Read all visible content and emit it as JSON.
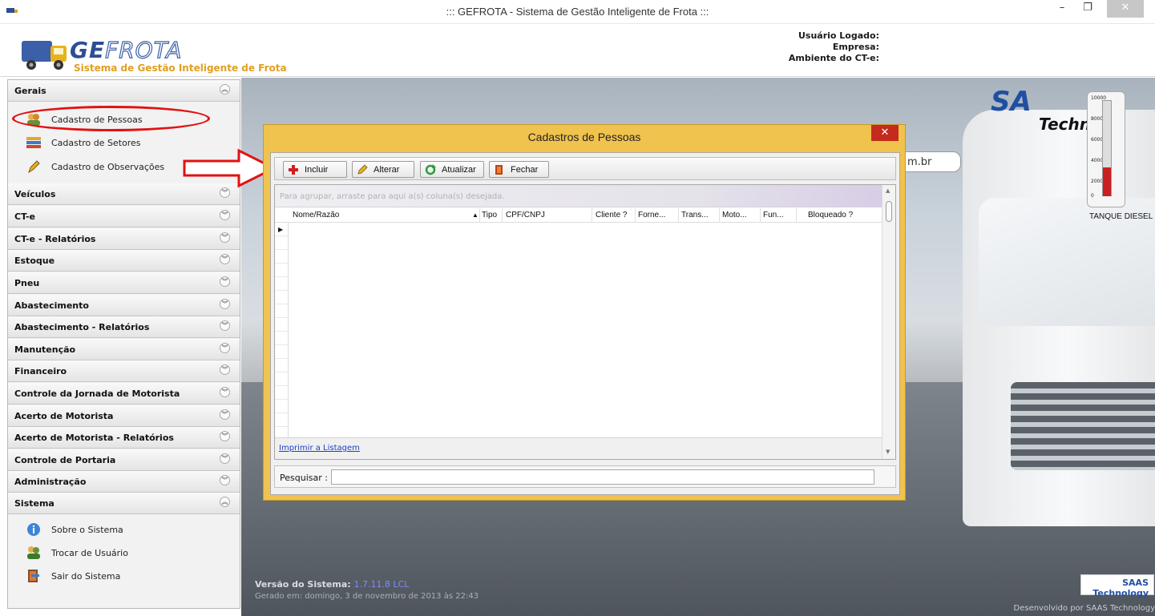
{
  "window": {
    "title": "::: GEFROTA - Sistema de Gestão Inteligente de Frota :::",
    "minimize": "–",
    "maximize": "❐",
    "close": "✕"
  },
  "header": {
    "brand_part1": "GE",
    "brand_part2": "FROTA",
    "subtitle": "Sistema de Gestão Inteligente de Frota",
    "user_logged_label": "Usuário Logado:",
    "company_label": "Empresa:",
    "cte_env_label": "Ambiente do CT-e:"
  },
  "sidebar": {
    "groups": [
      {
        "label": "Gerais",
        "expanded": true,
        "items": [
          {
            "label": "Cadastro de Pessoas",
            "icon": "people-icon"
          },
          {
            "label": "Cadastro de Setores",
            "icon": "stack-icon"
          },
          {
            "label": "Cadastro de Observações",
            "icon": "pencil-icon"
          }
        ]
      },
      {
        "label": "Veículos",
        "expanded": false
      },
      {
        "label": "CT-e",
        "expanded": false
      },
      {
        "label": "CT-e - Relatórios",
        "expanded": false
      },
      {
        "label": "Estoque",
        "expanded": false
      },
      {
        "label": "Pneu",
        "expanded": false
      },
      {
        "label": "Abastecimento",
        "expanded": false
      },
      {
        "label": "Abastecimento - Relatórios",
        "expanded": false
      },
      {
        "label": "Manutenção",
        "expanded": false
      },
      {
        "label": "Financeiro",
        "expanded": false
      },
      {
        "label": "Controle da Jornada de Motorista",
        "expanded": false
      },
      {
        "label": "Acerto de Motorista",
        "expanded": false
      },
      {
        "label": "Acerto de Motorista - Relatórios",
        "expanded": false
      },
      {
        "label": "Controle de Portaria",
        "expanded": false
      },
      {
        "label": "Administração",
        "expanded": false
      },
      {
        "label": "Sistema",
        "expanded": true,
        "items": [
          {
            "label": "Sobre o Sistema",
            "icon": "info-icon"
          },
          {
            "label": "Trocar de Usuário",
            "icon": "users-icon"
          },
          {
            "label": "Sair do Sistema",
            "icon": "exit-icon"
          }
        ]
      }
    ],
    "chev_up": "︽",
    "chev_down": "︾"
  },
  "background": {
    "site_fragment": "m.br",
    "saas_logo": "SA",
    "saas_tech": "Techn",
    "tank_label": "TANQUE DIESEL",
    "gauge_ticks": [
      "10000",
      "8000",
      "6000",
      "4000",
      "2000",
      "0"
    ],
    "tank_level_percent": 30,
    "version_label": "Versão do Sistema:",
    "version_number": "1.7.11.8 LCL",
    "generated": "Gerado em: domingo, 3 de novembro de 2013 às 22:43",
    "footer_logo": "SAAS Technology",
    "developed_by": "Desenvolvido por SAAS Technology"
  },
  "dialog": {
    "title": "Cadastros de Pessoas",
    "close": "✕",
    "toolbar": {
      "include": "Incluir",
      "alter": "Alterar",
      "update": "Atualizar",
      "close": "Fechar"
    },
    "grid": {
      "group_hint": "Para agrupar, arraste para aqui a(s) coluna(s) desejada.",
      "columns": [
        "Nome/Razão",
        "Tipo",
        "CPF/CNPJ",
        "Cliente ?",
        "Forne...",
        "Trans...",
        "Moto...",
        "Fun...",
        "Bloqueado ?"
      ],
      "sort_indicator": "▲",
      "row_pointer": "▶",
      "print_link": "Imprimir a Listagem"
    },
    "search_label": "Pesquisar :",
    "search_value": ""
  },
  "colors": {
    "dialog_frame": "#f0c24e",
    "close_red": "#c42b1c",
    "highlight_red": "#e21212",
    "brand_blue": "#2c4f93",
    "brand_orange": "#e0a020"
  }
}
